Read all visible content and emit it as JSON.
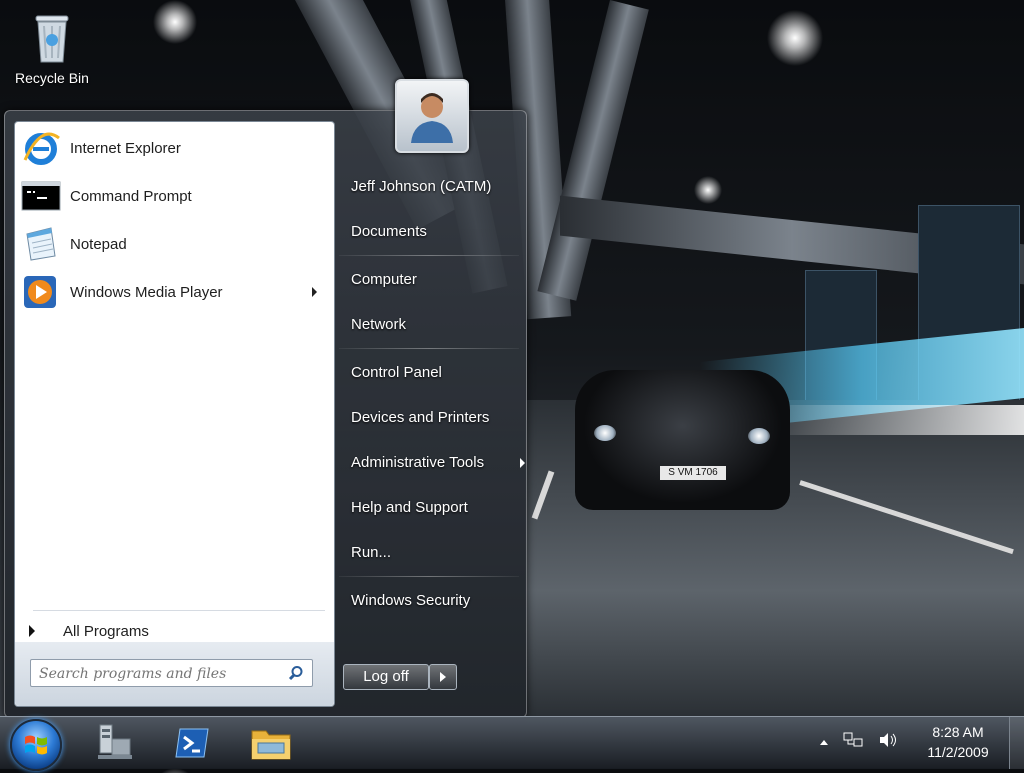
{
  "desktop": {
    "recycle_bin_label": "Recycle Bin",
    "wallpaper_plate": "S VM 1706"
  },
  "start_menu": {
    "pinned_programs": [
      {
        "label": "Internet Explorer",
        "icon": "internet-explorer-icon",
        "has_submenu": false
      },
      {
        "label": "Command Prompt",
        "icon": "command-prompt-icon",
        "has_submenu": false
      },
      {
        "label": "Notepad",
        "icon": "notepad-icon",
        "has_submenu": false
      },
      {
        "label": "Windows Media Player",
        "icon": "media-player-icon",
        "has_submenu": true
      }
    ],
    "all_programs_label": "All Programs",
    "search_placeholder": "Search programs and files",
    "right_column": [
      {
        "label": "Jeff Johnson (CATM)",
        "has_submenu": false
      },
      {
        "label": "Documents",
        "has_submenu": false
      },
      {
        "label": "Computer",
        "has_submenu": false
      },
      {
        "label": "Network",
        "has_submenu": false
      },
      {
        "label": "Control Panel",
        "has_submenu": false
      },
      {
        "label": "Devices and Printers",
        "has_submenu": false
      },
      {
        "label": "Administrative Tools",
        "has_submenu": true
      },
      {
        "label": "Help and Support",
        "has_submenu": false
      },
      {
        "label": "Run...",
        "has_submenu": false
      },
      {
        "label": "Windows Security",
        "has_submenu": false
      }
    ],
    "logoff_label": "Log off"
  },
  "taskbar": {
    "pinned": [
      "server-manager-icon",
      "powershell-icon",
      "windows-explorer-icon"
    ],
    "clock_time": "8:28 AM",
    "clock_date": "11/2/2009"
  },
  "colors": {
    "accent": "#2d7bd5",
    "menu_bg": "#ffffff"
  }
}
